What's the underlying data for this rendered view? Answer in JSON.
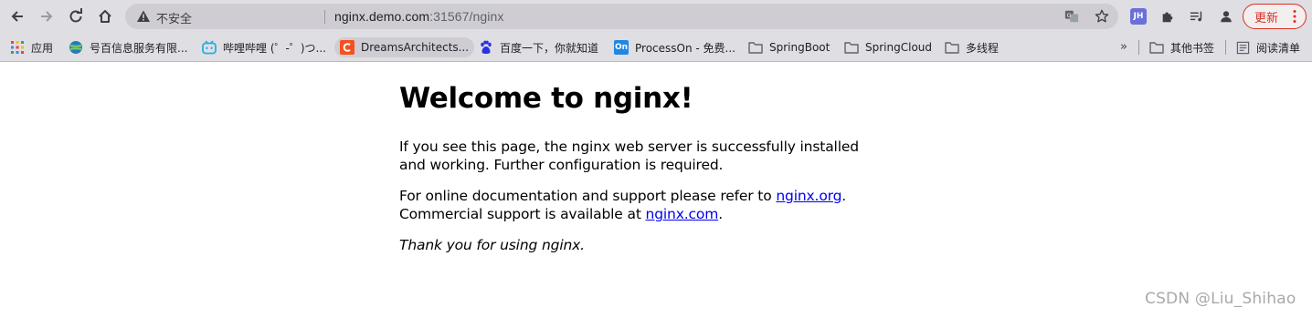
{
  "browser": {
    "security_label": "不安全",
    "url_host": "nginx.demo.com",
    "url_rest": ":31567/nginx",
    "extension_badge": "JH",
    "update_label": "更新",
    "update_color": "#d93025"
  },
  "bookmarks": {
    "items": [
      {
        "label": "应用",
        "icon": "apps-grid-icon"
      },
      {
        "label": "号百信息服务有限...",
        "icon": "globe-icon"
      },
      {
        "label": "哔哩哔哩 (゜-゜)つ...",
        "icon": "bilibili-icon"
      },
      {
        "label": "DreamsArchitects...",
        "icon": "c-logo-icon"
      },
      {
        "label": "百度一下，你就知道",
        "icon": "baidu-paw-icon"
      },
      {
        "label": "ProcessOn - 免费...",
        "icon": "processon-icon"
      },
      {
        "label": "SpringBoot",
        "icon": "folder-icon"
      },
      {
        "label": "SpringCloud",
        "icon": "folder-icon"
      },
      {
        "label": "多线程",
        "icon": "folder-icon"
      }
    ],
    "overflow": "»",
    "other_bookmarks": "其他书签",
    "reading_list": "阅读清单",
    "processon_badge": "On"
  },
  "page": {
    "heading": "Welcome to nginx!",
    "p1": "If you see this page, the nginx web server is successfully installed and working. Further configuration is required.",
    "p2_before": "For online documentation and support please refer to ",
    "p2_link": "nginx.org",
    "p2_after": ".",
    "p3_before": "Commercial support is available at ",
    "p3_link": "nginx.com",
    "p3_after": ".",
    "thanks": "Thank you for using nginx.",
    "link_color": "#0000ee"
  },
  "watermark": "CSDN @Liu_Shihao"
}
